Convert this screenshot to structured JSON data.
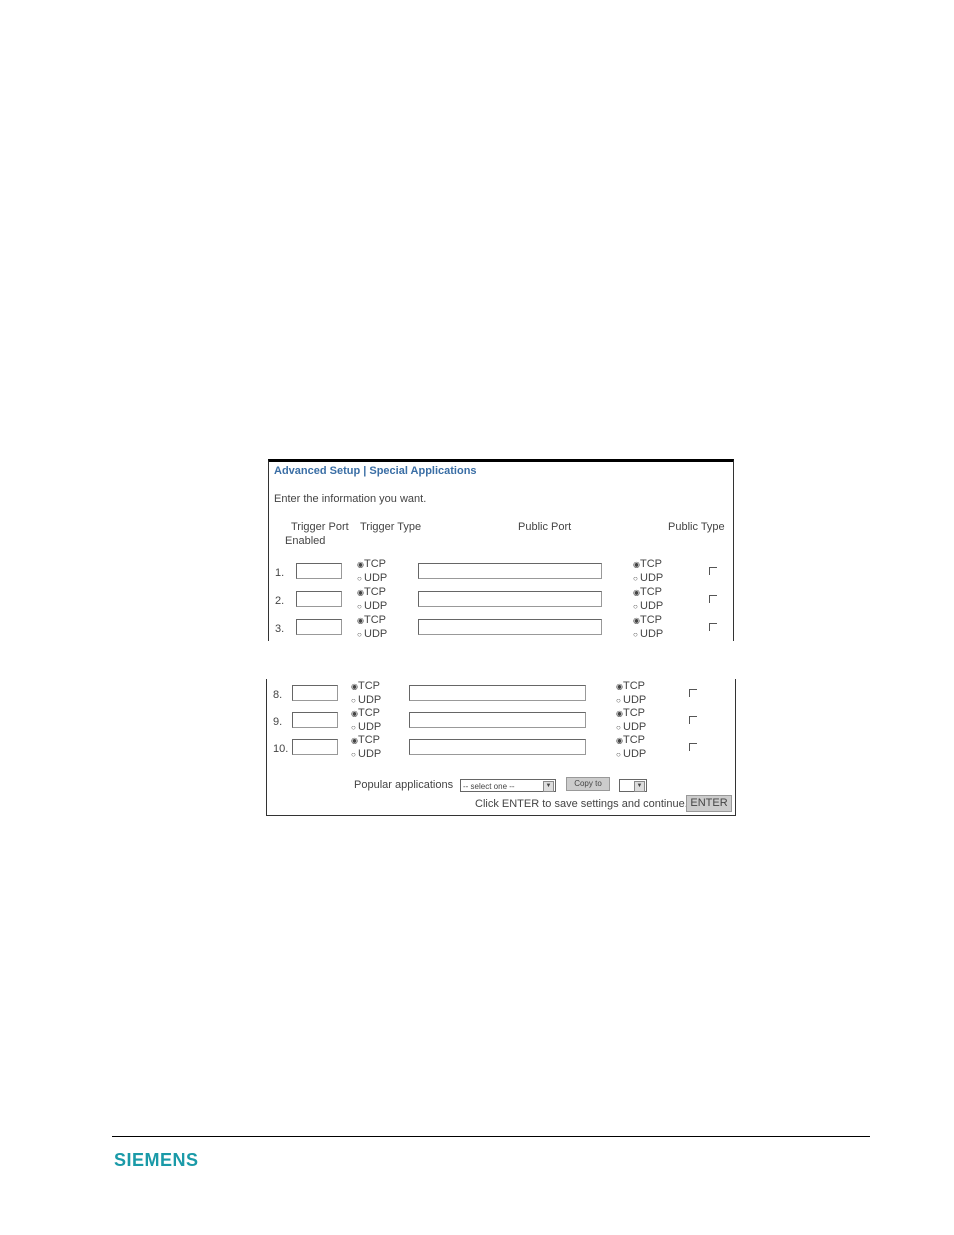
{
  "top_panel": {
    "title": "Advanced Setup | Special Applications",
    "intro": "Enter the information you want.",
    "headers": {
      "trigger_port": "Trigger Port",
      "enabled": "Enabled",
      "trigger_type": "Trigger Type",
      "public_port": "Public Port",
      "public_type": "Public Type"
    },
    "rows": [
      {
        "num": "1.",
        "trigger_port": "",
        "trigger_type": "TCP",
        "public_port": "",
        "public_type": "TCP",
        "enabled": false
      },
      {
        "num": "2.",
        "trigger_port": "",
        "trigger_type": "TCP",
        "public_port": "",
        "public_type": "TCP",
        "enabled": false
      },
      {
        "num": "3.",
        "trigger_port": "",
        "trigger_type": "TCP",
        "public_port": "",
        "public_type": "TCP",
        "enabled": false
      }
    ]
  },
  "bottom_panel": {
    "rows": [
      {
        "num": "8.",
        "trigger_port": "",
        "trigger_type": "TCP",
        "public_port": "",
        "public_type": "TCP",
        "enabled": false
      },
      {
        "num": "9.",
        "trigger_port": "",
        "trigger_type": "TCP",
        "public_port": "",
        "public_type": "TCP",
        "enabled": false
      },
      {
        "num": "10.",
        "trigger_port": "",
        "trigger_type": "TCP",
        "public_port": "",
        "public_type": "TCP",
        "enabled": false
      }
    ],
    "popular_label": "Popular applications",
    "select_value": "-- select one --",
    "copy_button": "Copy to",
    "copy_target_value": "",
    "save_hint": "Click ENTER to save settings and continue.",
    "enter_button": "ENTER"
  },
  "radio_labels": {
    "tcp": "TCP",
    "udp": "UDP"
  },
  "icons": {
    "radio_on": "◉",
    "radio_off": "○",
    "dropdown": "▼"
  },
  "footer": {
    "logo": "SIEMENS",
    "logo_color": "#1a9aa8"
  },
  "colors": {
    "title": "#3a6ea5"
  }
}
